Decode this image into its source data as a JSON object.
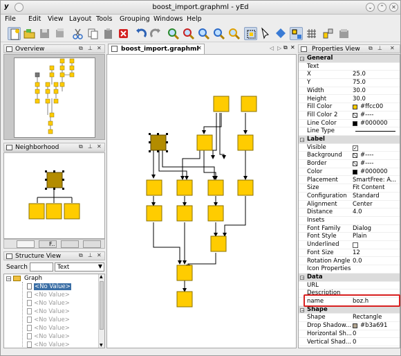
{
  "window": {
    "title": "boost_import.graphml - yEd"
  },
  "menu": [
    "File",
    "Edit",
    "View",
    "Layout",
    "Tools",
    "Grouping",
    "Windows",
    "Help"
  ],
  "overview": {
    "title": "Overview"
  },
  "neighborhood": {
    "title": "Neighborhood",
    "tabs": [
      "",
      "F..",
      "",
      ""
    ]
  },
  "structure": {
    "title": "Structure View",
    "search_label": "Search",
    "search_value": "",
    "filter_value": "Text",
    "root": "Graph",
    "selected_item": "<No Value>",
    "items": [
      "<No Value>",
      "<No Value>",
      "<No Value>",
      "<No Value>",
      "<No Value>",
      "<No Value>",
      "<No Value>",
      "<No Value>",
      "<No Value>",
      "<No Value>"
    ]
  },
  "editor": {
    "tab_label": "boost_import.graphml"
  },
  "properties": {
    "title": "Properties View",
    "rows": [
      {
        "type": "sec",
        "k": "General"
      },
      {
        "k": "Text",
        "v": ""
      },
      {
        "k": "X",
        "v": "25.0"
      },
      {
        "k": "Y",
        "v": "75.0"
      },
      {
        "k": "Width",
        "v": "30.0"
      },
      {
        "k": "Height",
        "v": "30.0"
      },
      {
        "k": "Fill Color",
        "v": "#ffcc00",
        "swatch": "#ffcc00"
      },
      {
        "k": "Fill Color 2",
        "v": "#----",
        "swatch": "none"
      },
      {
        "k": "Line Color",
        "v": "#000000",
        "swatch": "#000000"
      },
      {
        "k": "Line Type",
        "v": "",
        "line": true
      },
      {
        "type": "sec",
        "k": "Label"
      },
      {
        "k": "Visible",
        "v": "",
        "check": true
      },
      {
        "k": "Background",
        "v": "#----",
        "swatch": "none"
      },
      {
        "k": "Border",
        "v": "#----",
        "swatch": "none"
      },
      {
        "k": "Color",
        "v": "#000000",
        "swatch": "#000000"
      },
      {
        "k": "Placement",
        "v": "SmartFree: A..."
      },
      {
        "k": "Size",
        "v": "Fit Content"
      },
      {
        "k": "Configuration",
        "v": "Standard"
      },
      {
        "k": "Alignment",
        "v": "Center"
      },
      {
        "k": "Distance",
        "v": "4.0"
      },
      {
        "k": "Insets",
        "v": ""
      },
      {
        "k": "Font Family",
        "v": "Dialog"
      },
      {
        "k": "Font Style",
        "v": "Plain"
      },
      {
        "k": "Underlined",
        "v": "",
        "check": false
      },
      {
        "k": "Font Size",
        "v": "12"
      },
      {
        "k": "Rotation Angle",
        "v": "0.0"
      },
      {
        "k": "Icon Properties",
        "v": ""
      },
      {
        "type": "sec",
        "k": "Data"
      },
      {
        "k": "URL",
        "v": ""
      },
      {
        "k": "Description",
        "v": ""
      },
      {
        "k": "name",
        "v": "boz.h",
        "highlight": true
      },
      {
        "type": "sec",
        "k": "Shape"
      },
      {
        "k": "Shape",
        "v": "Rectangle"
      },
      {
        "k": "Drop Shadow...",
        "v": "#b3a691",
        "swatch": "#b3a691"
      },
      {
        "k": "Horizontal Sh...",
        "v": "0"
      },
      {
        "k": "Vertical Shad...",
        "v": "0"
      }
    ]
  },
  "colors": {
    "node": "#ffcc00",
    "selected_node": "#b3a691",
    "highlight": "#d82020"
  }
}
